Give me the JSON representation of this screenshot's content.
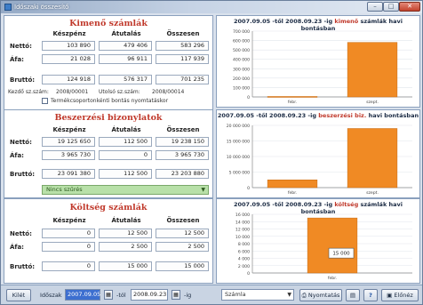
{
  "window": {
    "title": "Időszaki összesítő",
    "min_icon": "minimize-icon",
    "max_icon": "maximize-icon",
    "close_icon": "close-icon"
  },
  "kimeno": {
    "title": "Kimenő számlák",
    "col_headers": [
      "Készpénz",
      "Átutalás",
      "Összesen"
    ],
    "rows": [
      {
        "label": "Nettó:",
        "values": [
          "103 890",
          "479 406",
          "583 296"
        ]
      },
      {
        "label": "Áfa:",
        "values": [
          "21 028",
          "96 911",
          "117 939"
        ]
      },
      {
        "label": "Bruttó:",
        "values": [
          "124 918",
          "576 317",
          "701 235"
        ]
      }
    ],
    "first_invoice_label": "Kezdő sz.szám:",
    "first_invoice": "2008/00001",
    "last_invoice_label": "Utolsó sz.szám:",
    "last_invoice": "2008/00014",
    "checkbox_label": "Termékcsoportonkénti bontás nyomtatáskor",
    "checkbox_checked": false
  },
  "beszerzesi": {
    "title": "Beszerzési bizonylatok",
    "col_headers": [
      "Készpénz",
      "Átutalás",
      "Összesen"
    ],
    "rows": [
      {
        "label": "Nettó:",
        "values": [
          "19 125 650",
          "112 500",
          "19 238 150"
        ]
      },
      {
        "label": "Áfa:",
        "values": [
          "3 965 730",
          "0",
          "3 965 730"
        ]
      },
      {
        "label": "Bruttó:",
        "values": [
          "23 091 380",
          "112 500",
          "23 203 880"
        ]
      }
    ],
    "filter_text": "Nincs szűrés"
  },
  "koltseg": {
    "title": "Költség számlák",
    "col_headers": [
      "Készpénz",
      "Átutalás",
      "Összesen"
    ],
    "rows": [
      {
        "label": "Nettó:",
        "values": [
          "0",
          "12 500",
          "12 500"
        ]
      },
      {
        "label": "Áfa:",
        "values": [
          "0",
          "2 500",
          "2 500"
        ]
      },
      {
        "label": "Bruttó:",
        "values": [
          "0",
          "15 000",
          "15 000"
        ]
      }
    ]
  },
  "charts": {
    "c1": {
      "prefix": "2007.09.05 -től 2008.09.23 -ig",
      "accent": "kimenő",
      "suffix": "számlák havi bontásban"
    },
    "c2": {
      "prefix": "2007.09.05 -től 2008.09.23 -ig",
      "accent": "beszerzési biz.",
      "suffix": "havi bontásban"
    },
    "c3": {
      "prefix": "2007.09.05 -től 2008.09.23 -ig",
      "accent": "költség",
      "suffix": "számlák havi bontásban"
    }
  },
  "chart_data": [
    {
      "type": "bar",
      "categories": [
        "febr.",
        "szept."
      ],
      "values": [
        5000,
        580000
      ],
      "ylim": [
        0,
        700000
      ],
      "yticks": [
        "700 000",
        "600 000",
        "500 000",
        "400 000",
        "300 000",
        "200 000",
        "100 000",
        "0"
      ],
      "bar_color": "#f08a24"
    },
    {
      "type": "bar",
      "categories": [
        "febr.",
        "szept."
      ],
      "values": [
        2500000,
        19000000
      ],
      "ylim": [
        0,
        20000000
      ],
      "yticks": [
        "20 000 000",
        "15 000 000",
        "10 000 000",
        "5 000 000",
        "0"
      ],
      "bar_color": "#f08a24"
    },
    {
      "type": "bar",
      "categories": [
        "febr."
      ],
      "values": [
        15000
      ],
      "data_label": "15 000",
      "ylim": [
        0,
        16000
      ],
      "yticks": [
        "16 000",
        "14 000",
        "12 000",
        "10 000",
        "8 000",
        "6 000",
        "4 000",
        "2 000",
        "0"
      ],
      "bar_color": "#f08a24"
    }
  ],
  "bottombar": {
    "close_label": "Kilét",
    "period_label": "Időszak",
    "date_from": "2007.09.05",
    "date_sep": "-tól",
    "date_to": "2008.09.23",
    "date_suffix": "-ig",
    "report_select": "Számla",
    "print_label": "Nyomtatás",
    "help_label": "?",
    "preview_label": "Előnéz"
  },
  "colors": {
    "panel_title": "#c0392b",
    "bar": "#f08a24",
    "filter_bg": "#b8e0a8"
  }
}
